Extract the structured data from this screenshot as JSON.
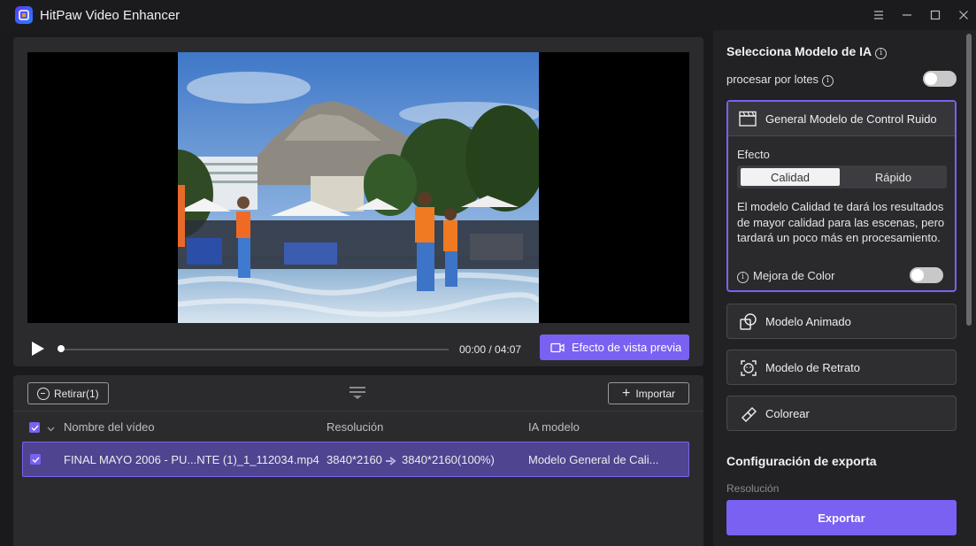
{
  "window": {
    "title": "HitPaw Video Enhancer",
    "controls": [
      "menu-icon",
      "minimize-icon",
      "maximize-icon",
      "close-icon"
    ]
  },
  "preview": {
    "time": "00:00 / 04:07",
    "progress_fraction": 0.0,
    "preview_effect_label": "Efecto de vista previa"
  },
  "file_list": {
    "remove_label": "Retirar(1)",
    "import_label": "Importar",
    "headers": {
      "name": "Nombre del vídeo",
      "resolution": "Resolución",
      "model": "IA modelo"
    },
    "rows": [
      {
        "checked": true,
        "name": "FINAL MAYO 2006 - PU...NTE (1)_1_112034.mp4",
        "resolution_from": "3840*2160",
        "resolution_to": "3840*2160(100%)",
        "model": "Modelo General de Cali..."
      }
    ]
  },
  "ai_panel": {
    "title": "Selecciona Modelo de IA",
    "batch_label": "procesar por lotes",
    "batch_enabled": false,
    "active_model": {
      "label": "General Modelo de Control Ruido",
      "effect_label": "Efecto",
      "options": [
        "Calidad",
        "Rápido"
      ],
      "selected": "Calidad",
      "description": "El modelo Calidad te dará los resultados de mayor calidad para las escenas, pero tardará un poco más en procesamiento.",
      "color_enhance_label": "Mejora de Color",
      "color_enhance_enabled": false
    },
    "models": [
      {
        "label": "Modelo Animado",
        "icon": "animation-icon"
      },
      {
        "label": "Modelo de Retrato",
        "icon": "face-icon"
      },
      {
        "label": "Colorear",
        "icon": "colorize-icon"
      }
    ]
  },
  "export": {
    "title": "Configuración de exporta",
    "resolution_label": "Resolución",
    "button_label": "Exportar"
  },
  "colors": {
    "accent": "#7b61f2",
    "row_selected": "#4e4490",
    "panel": "#2b2b2e",
    "background": "#1a1a1c"
  }
}
